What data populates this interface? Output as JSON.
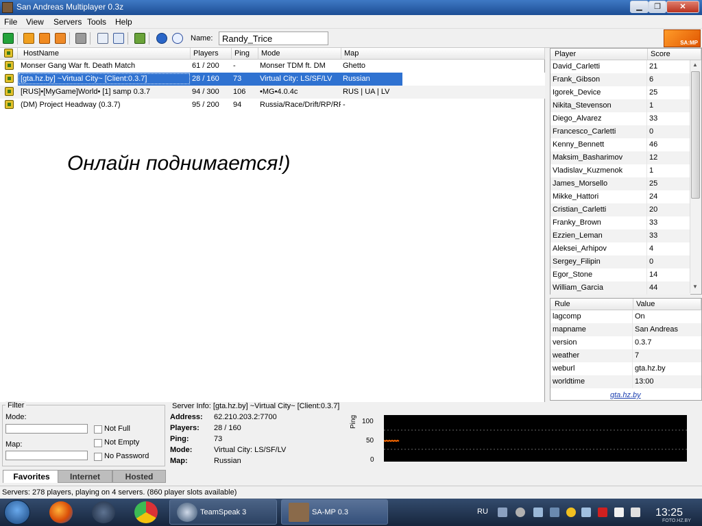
{
  "window": {
    "title": "San Andreas Multiplayer 0.3z",
    "min": "▁",
    "max": "❐",
    "close": "✕"
  },
  "menu": [
    "File",
    "View",
    "Servers",
    "Tools",
    "Help"
  ],
  "toolbar": {
    "name_label": "Name:",
    "name_value": "Randy_Trice",
    "logo_text": "SA:MP"
  },
  "server_list": {
    "columns": [
      "HostName",
      "Players",
      "Ping",
      "Mode",
      "Map"
    ],
    "rows": [
      [
        "Monser Gang War ft. Death Match",
        "61 / 200",
        "-",
        "Monser TDM ft. DM",
        "Ghetto"
      ],
      [
        "[gta.hz.by] ~Virtual City~ [Client:0.3.7]",
        "28 / 160",
        "73",
        "Virtual City: LS/SF/LV",
        "Russian"
      ],
      [
        "[RUS]•[MyGame]World• [1]  samp 0.3.7",
        "94 / 300",
        "106",
        "•MG•4.0.4c",
        "RUS | UA | LV"
      ],
      [
        "(DM) Project Headway (0.3.7)",
        "95 / 200",
        "94",
        "Russia/Race/Drift/RP/RF",
        "-"
      ]
    ],
    "selected_index": 1,
    "overlay_text": "Онлайн поднимается!)"
  },
  "players": {
    "columns": [
      "Player",
      "Score"
    ],
    "rows": [
      [
        "David_Carletti",
        "21"
      ],
      [
        "Frank_Gibson",
        "6"
      ],
      [
        "Igorek_Device",
        "25"
      ],
      [
        "Nikita_Stevenson",
        "1"
      ],
      [
        "Diego_Alvarez",
        "33"
      ],
      [
        "Francesco_Carletti",
        "0"
      ],
      [
        "Kenny_Bennett",
        "46"
      ],
      [
        "Maksim_Basharimov",
        "12"
      ],
      [
        "Vladislav_Kuzmenok",
        "1"
      ],
      [
        "James_Morsello",
        "25"
      ],
      [
        "Mikke_Hattori",
        "24"
      ],
      [
        "Cristian_Carletti",
        "20"
      ],
      [
        "Franky_Brown",
        "33"
      ],
      [
        "Ezzien_Leman",
        "33"
      ],
      [
        "Aleksei_Arhipov",
        "4"
      ],
      [
        "Sergey_Filipin",
        "0"
      ],
      [
        "Egor_Stone",
        "14"
      ],
      [
        "William_Garcia",
        "44"
      ]
    ]
  },
  "rules": {
    "columns": [
      "Rule",
      "Value"
    ],
    "rows": [
      [
        "lagcomp",
        "On"
      ],
      [
        "mapname",
        "San Andreas"
      ],
      [
        "version",
        "0.3.7"
      ],
      [
        "weather",
        "7"
      ],
      [
        "weburl",
        "gta.hz.by"
      ],
      [
        "worldtime",
        "13:00"
      ]
    ],
    "link": "gta.hz.by"
  },
  "filter": {
    "title": "Filter",
    "mode_label": "Mode:",
    "map_label": "Map:",
    "not_full": "Not Full",
    "not_empty": "Not Empty",
    "no_password": "No Password"
  },
  "server_info": {
    "title": "Server Info: [gta.hz.by] ~Virtual City~ [Client:0.3.7]",
    "address_label": "Address:",
    "address": "62.210.203.2:7700",
    "players_label": "Players:",
    "players": "28 / 160",
    "ping_label": "Ping:",
    "ping": "73",
    "mode_label": "Mode:",
    "mode": "Virtual City: LS/SF/LV",
    "map_label": "Map:",
    "map": "Russian"
  },
  "ping_graph": {
    "axis_label": "Ping",
    "ticks": [
      "100",
      "50",
      "0"
    ],
    "line_color": "#ff6a00"
  },
  "tabs": [
    "Favorites",
    "Internet",
    "Hosted"
  ],
  "status": "Servers: 278 players, playing on 4 servers. (860 player slots available)",
  "taskbar": {
    "apps": [
      "firefox-icon",
      "steam-icon",
      "chrome-icon"
    ],
    "tasks": [
      "TeamSpeak 3",
      "SA-MP 0.3"
    ],
    "lang": "RU",
    "clock": "13:25",
    "watermark": "FOTO.HZ.BY"
  }
}
